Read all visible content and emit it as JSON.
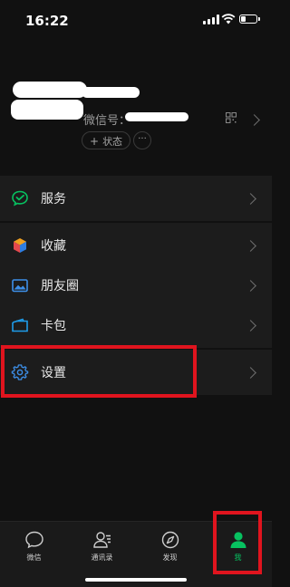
{
  "status_bar": {
    "time": "16:22",
    "battery_level": 0.3
  },
  "profile": {
    "wechat_id_label": "微信号：",
    "status_button": "状态",
    "status_plus": "+",
    "more_button": "···"
  },
  "menu": [
    {
      "label": "服务",
      "icon": "wechat-pay-icon"
    },
    {
      "label": "收藏",
      "icon": "favorites-cube-icon"
    },
    {
      "label": "朋友圈",
      "icon": "moments-photo-icon"
    },
    {
      "label": "卡包",
      "icon": "card-wallet-icon"
    },
    {
      "label": "设置",
      "icon": "settings-gear-icon"
    }
  ],
  "tabbar": [
    {
      "label": "微信",
      "icon": "chat-bubble-icon"
    },
    {
      "label": "通讯录",
      "icon": "contacts-icon"
    },
    {
      "label": "发现",
      "icon": "compass-icon"
    },
    {
      "label": "我",
      "icon": "person-icon",
      "active": true
    }
  ],
  "colors": {
    "background": "#111111",
    "row_background": "#1c1c1c",
    "accent_green": "#07c160",
    "highlight_red": "#e0141e"
  }
}
